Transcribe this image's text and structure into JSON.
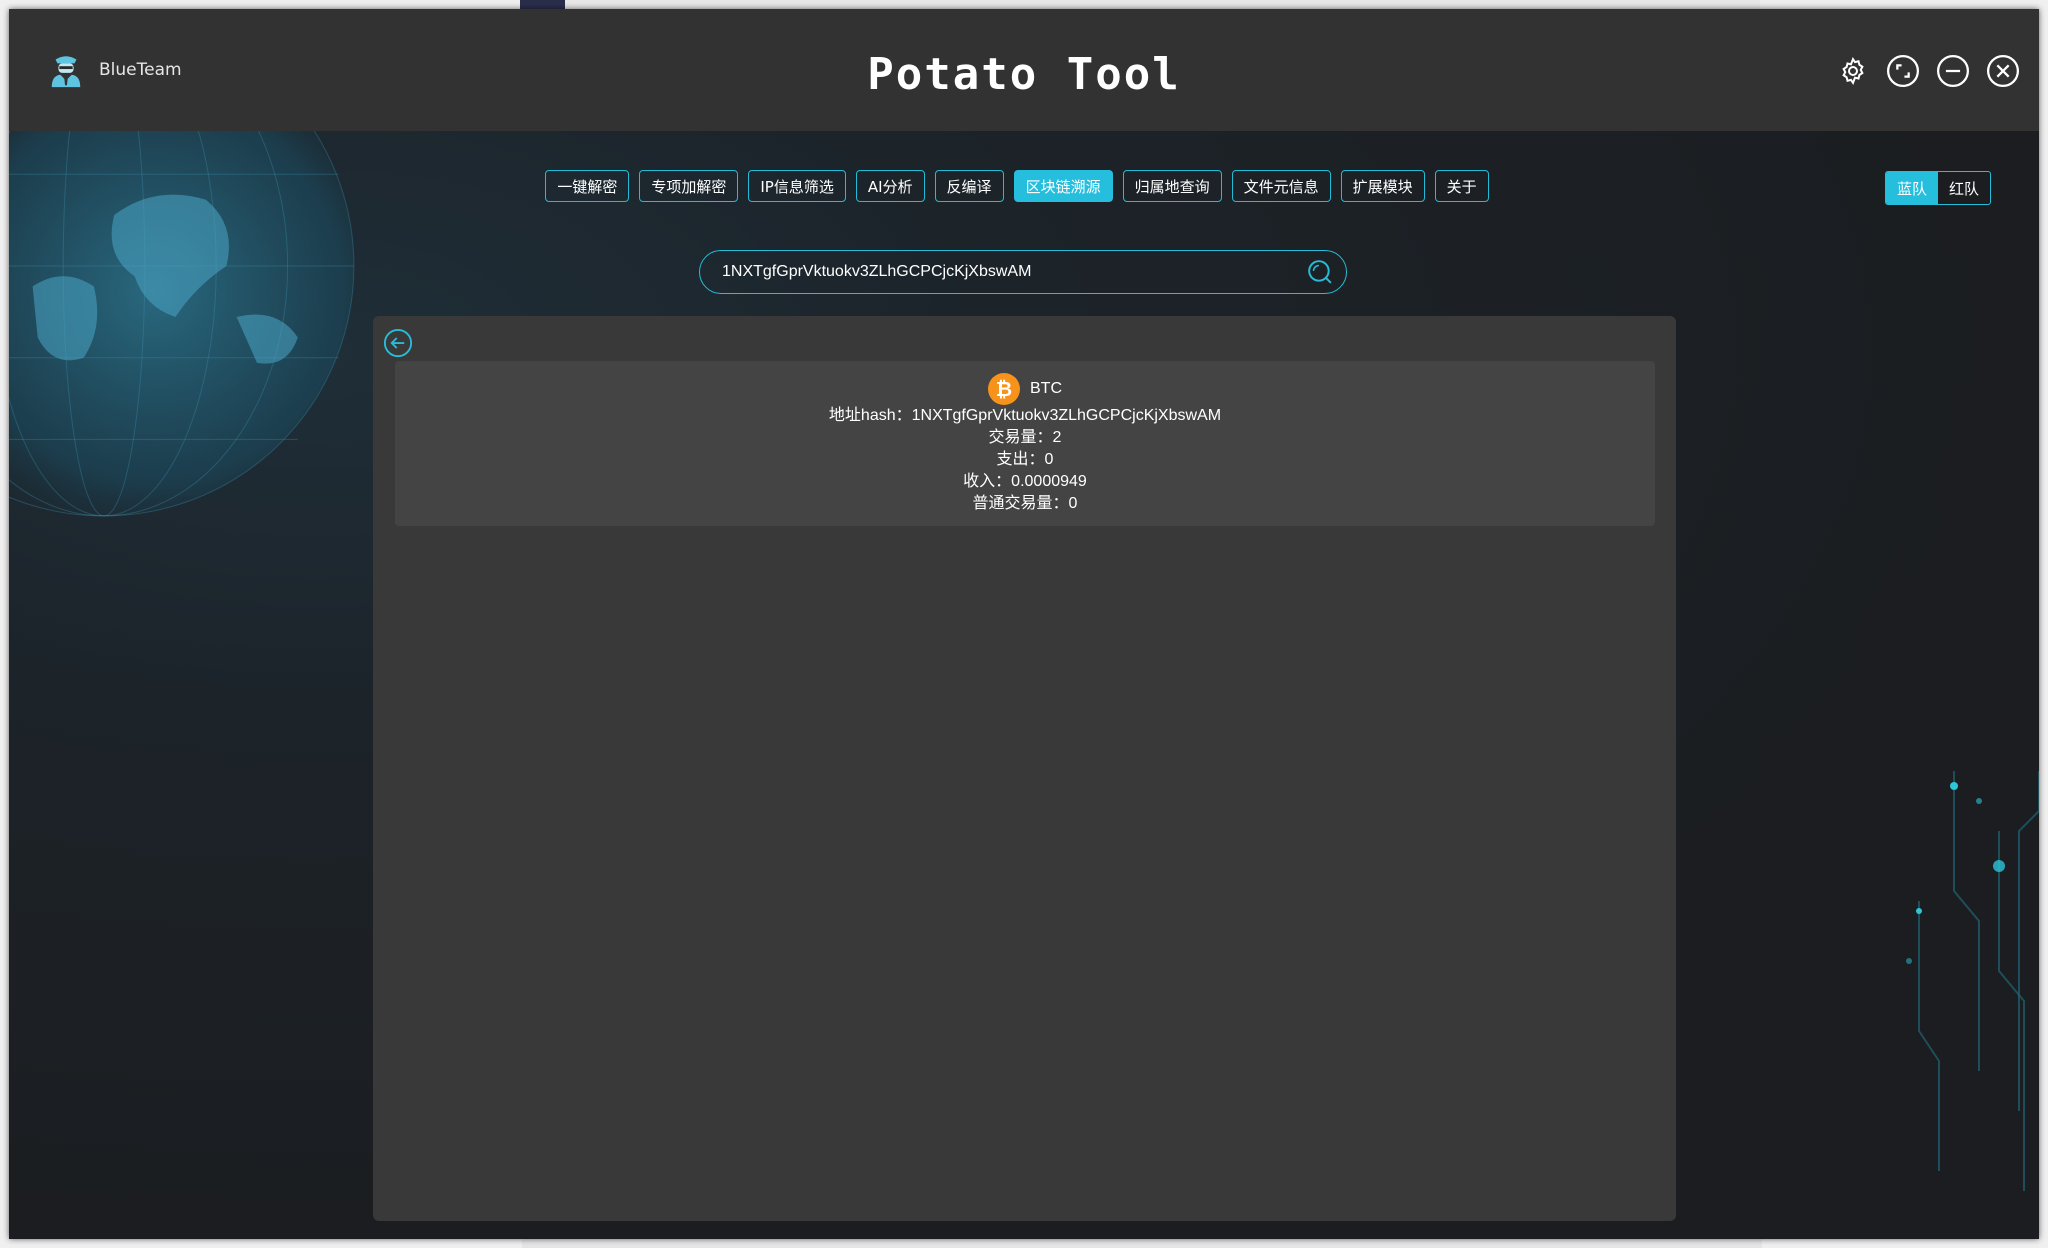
{
  "app": {
    "brand_name": "BlueTeam",
    "title": "Potato Tool"
  },
  "window_controls": [
    "settings-icon",
    "fullscreen-icon",
    "minimize-icon",
    "close-icon"
  ],
  "nav": {
    "tabs": [
      {
        "label": "一键解密",
        "active": false
      },
      {
        "label": "专项加解密",
        "active": false
      },
      {
        "label": "IP信息筛选",
        "active": false
      },
      {
        "label": "AI分析",
        "active": false
      },
      {
        "label": "反编译",
        "active": false
      },
      {
        "label": "区块链溯源",
        "active": true
      },
      {
        "label": "归属地查询",
        "active": false
      },
      {
        "label": "文件元信息",
        "active": false
      },
      {
        "label": "扩展模块",
        "active": false
      },
      {
        "label": "关于",
        "active": false
      }
    ]
  },
  "team": {
    "blue": "蓝队",
    "red": "红队",
    "selected": "蓝队"
  },
  "search": {
    "value": "1NXTgfGprVktuokv3ZLhGCPCjcKjXbswAM"
  },
  "result": {
    "coin": "BTC",
    "address_line": "地址hash：1NXTgfGprVktuokv3ZLhGCPCjcKjXbswAM",
    "tx_count_line": "交易量：2",
    "spent_line": "支出：0",
    "received_line": "收入：0.0000949",
    "normal_tx_line": "普通交易量：0"
  },
  "colors": {
    "accent": "#25bedd",
    "titlebar": "#323232",
    "panel": "#393939",
    "card": "#444444",
    "bitcoin": "#f7931a"
  }
}
